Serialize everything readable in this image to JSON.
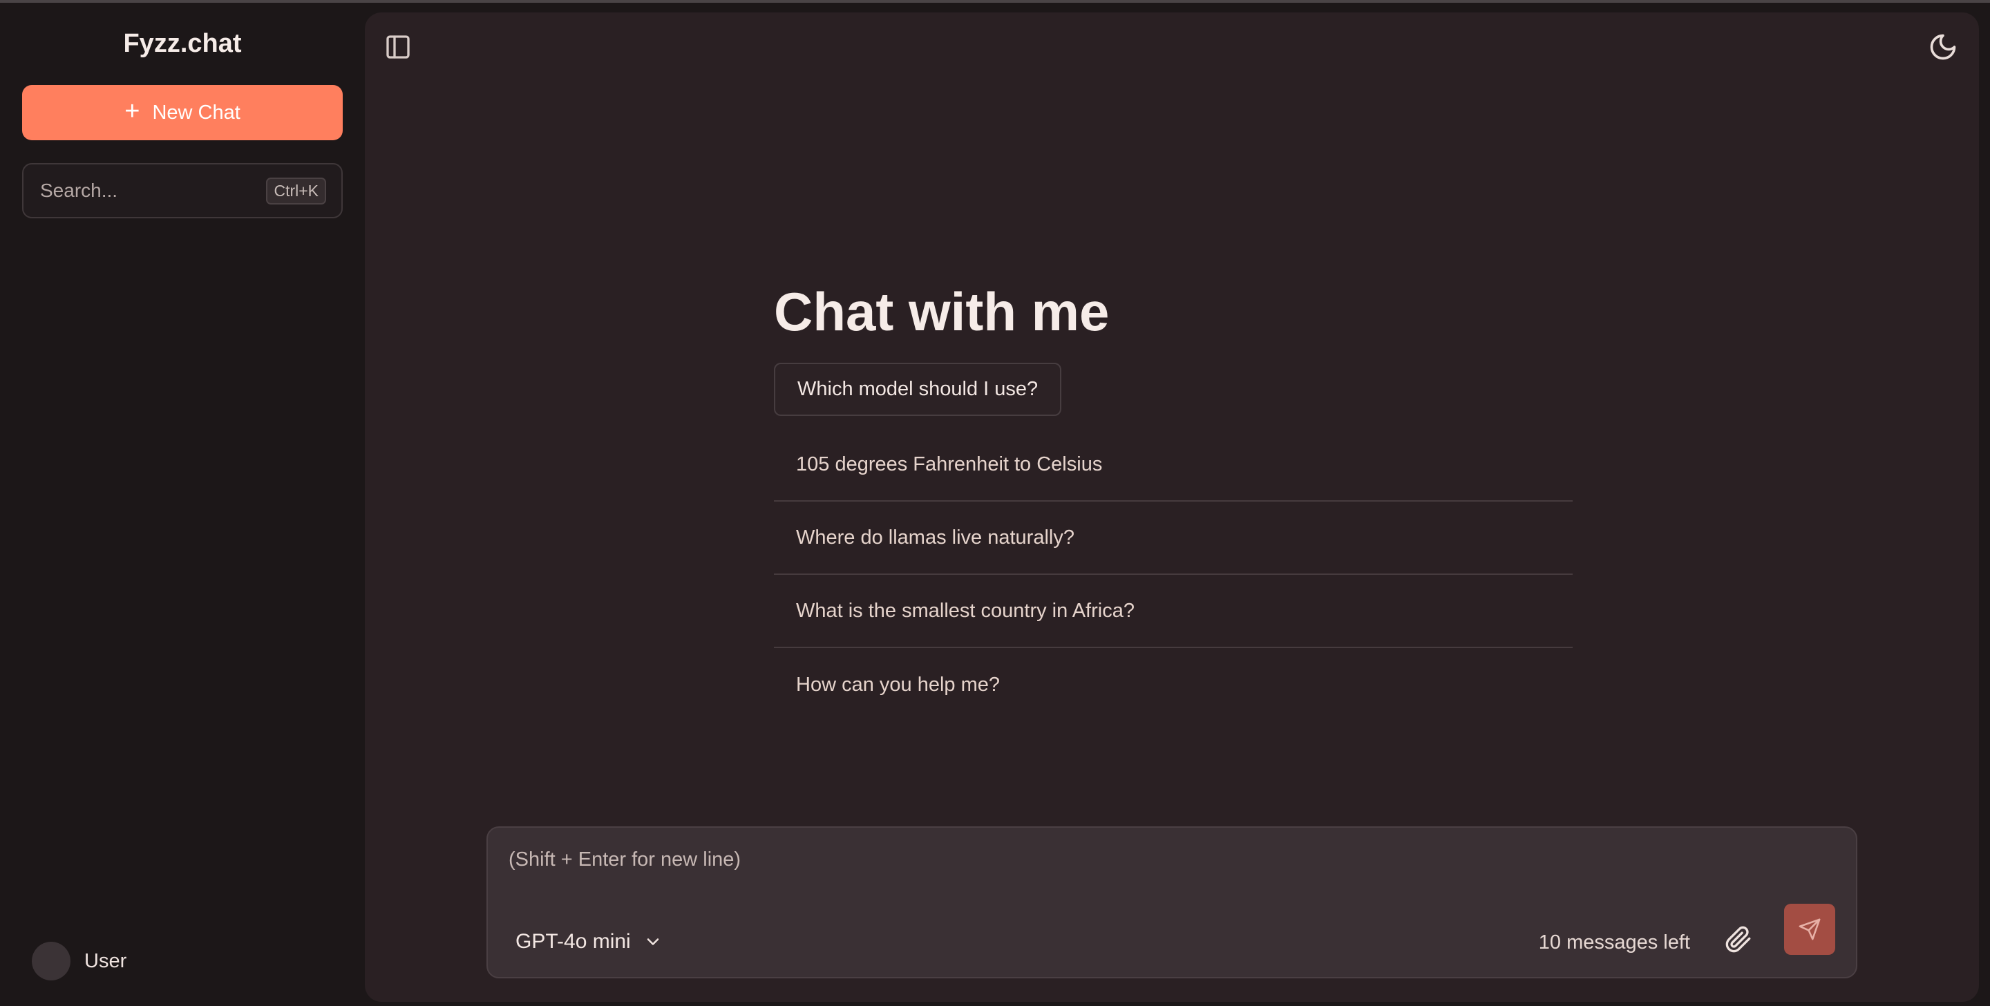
{
  "app": {
    "brand": "Fyzz.chat"
  },
  "sidebar": {
    "new_chat_label": "New Chat",
    "search_placeholder": "Search...",
    "search_shortcut": "Ctrl+K",
    "user_name": "User"
  },
  "main": {
    "title": "Chat with me",
    "model_question": "Which model should I use?",
    "suggestions": [
      "105 degrees Fahrenheit to Celsius",
      "Where do llamas live naturally?",
      "What is the smallest country in Africa?",
      "How can you help me?"
    ]
  },
  "composer": {
    "placeholder": "(Shift + Enter for new line)",
    "model": "GPT-4o mini",
    "messages_left": "10 messages left"
  },
  "icons": {
    "sidebar_toggle": "sidebar-toggle-icon",
    "theme": "moon-icon",
    "attach": "paperclip-icon",
    "send": "send-icon",
    "model_dropdown": "chevron-down-icon"
  },
  "colors": {
    "accent": "#ff7f5e",
    "send": "#a34d43",
    "panel": "#2a2023",
    "sidebar": "#1c1718"
  }
}
